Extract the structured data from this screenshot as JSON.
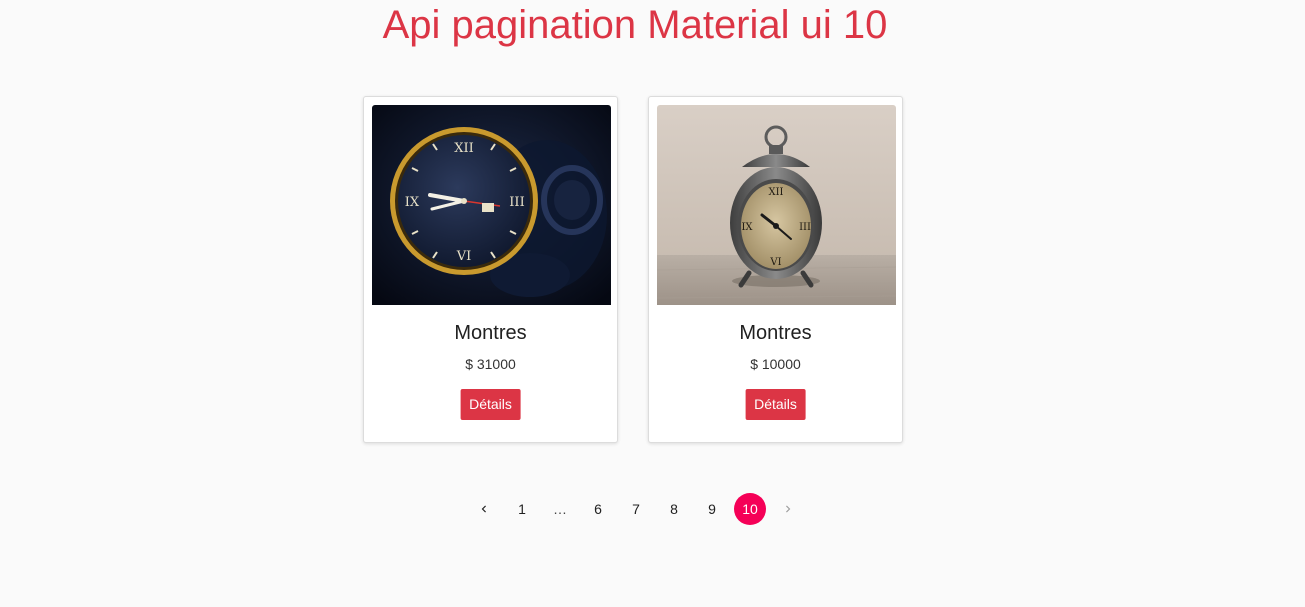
{
  "page": {
    "title": "Api pagination Material ui 10",
    "accent_color": "#dc3545",
    "pagination_selected_color": "#f50057"
  },
  "products": [
    {
      "title": "Montres",
      "price": "$ 31000",
      "button_label": "Détails",
      "image_icon": "wristwatch-photo"
    },
    {
      "title": "Montres",
      "price": "$ 10000",
      "button_label": "Détails",
      "image_icon": "alarm-clock-photo"
    }
  ],
  "pagination": {
    "prev_icon": "chevron-left-icon",
    "next_icon": "chevron-right-icon",
    "items": [
      "1",
      "…",
      "6",
      "7",
      "8",
      "9",
      "10"
    ],
    "current": "10"
  }
}
